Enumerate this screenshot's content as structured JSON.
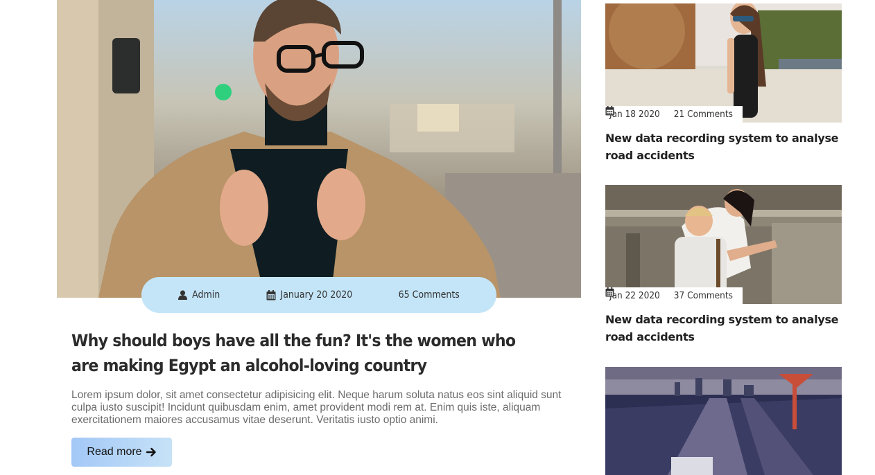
{
  "featured": {
    "meta": {
      "author": "Admin",
      "date": "January 20 2020",
      "comments": "65 Comments"
    },
    "title": "Why should boys have all the fun? It's the women who are making Egypt an alcohol-loving country",
    "excerpt": "Lorem ipsum dolor, sit amet consectetur adipisicing elit. Neque harum soluta natus eos sint aliquid sunt culpa iusto suscipit! Incidunt quibusdam enim, amet provident modi rem at. Enim quis iste, aliquam exercitationem maiores accusamus vitae deserunt. Veritatis iusto optio animi.",
    "read_more_label": "Read more"
  },
  "sidebar": {
    "posts": [
      {
        "date": "Jan 18 2020",
        "comments": "21 Comments",
        "title": "New data recording system to analyse road accidents"
      },
      {
        "date": "Jan 22 2020",
        "comments": "37 Comments",
        "title": "New data recording system to analyse road accidents"
      }
    ]
  },
  "colors": {
    "meta_pill": "#c4e5f8",
    "button_gradient_start": "#a3c8f7",
    "button_gradient_end": "#c6e2f7",
    "heading": "#2b2b2b",
    "excerpt": "#6b6b6b"
  },
  "icons": {
    "author": "user-icon",
    "date": "calendar-icon",
    "read_more": "arrow-right-icon"
  }
}
